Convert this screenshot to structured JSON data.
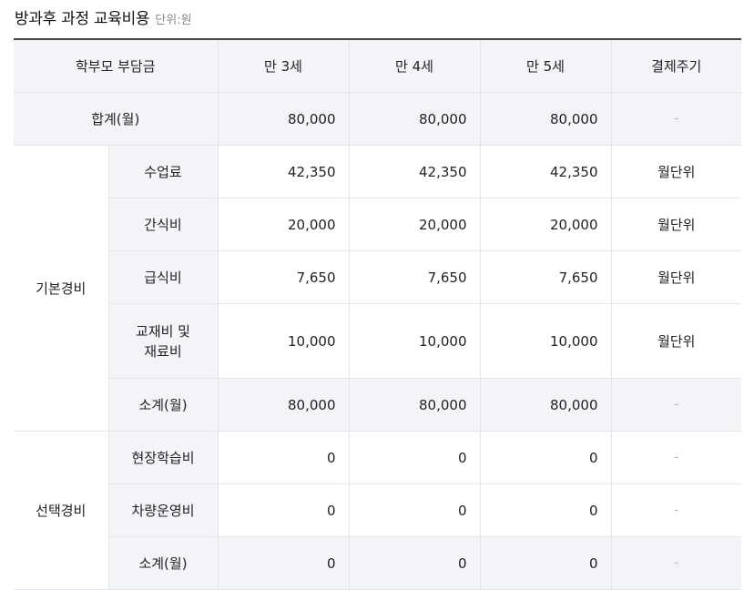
{
  "title": "방과후 과정 교육비용",
  "unit": "단위:원",
  "header": {
    "col0": "학부모 부담금",
    "age3": "만 3세",
    "age4": "만 4세",
    "age5": "만 5세",
    "cycle": "결제주기"
  },
  "total": {
    "label": "합계(월)",
    "age3": "80,000",
    "age4": "80,000",
    "age5": "80,000",
    "cycle": "-"
  },
  "basic": {
    "group": "기본경비",
    "items": [
      {
        "label": "수업료",
        "age3": "42,350",
        "age4": "42,350",
        "age5": "42,350",
        "cycle": "월단위"
      },
      {
        "label": "간식비",
        "age3": "20,000",
        "age4": "20,000",
        "age5": "20,000",
        "cycle": "월단위"
      },
      {
        "label": "급식비",
        "age3": "7,650",
        "age4": "7,650",
        "age5": "7,650",
        "cycle": "월단위"
      },
      {
        "label_line1": "교재비 및",
        "label_line2": "재료비",
        "age3": "10,000",
        "age4": "10,000",
        "age5": "10,000",
        "cycle": "월단위"
      }
    ],
    "subtotal": {
      "label": "소계(월)",
      "age3": "80,000",
      "age4": "80,000",
      "age5": "80,000",
      "cycle": "-"
    }
  },
  "optional": {
    "group": "선택경비",
    "items": [
      {
        "label": "현장학습비",
        "age3": "0",
        "age4": "0",
        "age5": "0",
        "cycle": "-"
      },
      {
        "label": "차량운영비",
        "age3": "0",
        "age4": "0",
        "age5": "0",
        "cycle": "-"
      }
    ],
    "subtotal": {
      "label": "소계(월)",
      "age3": "0",
      "age4": "0",
      "age5": "0",
      "cycle": "-"
    }
  }
}
